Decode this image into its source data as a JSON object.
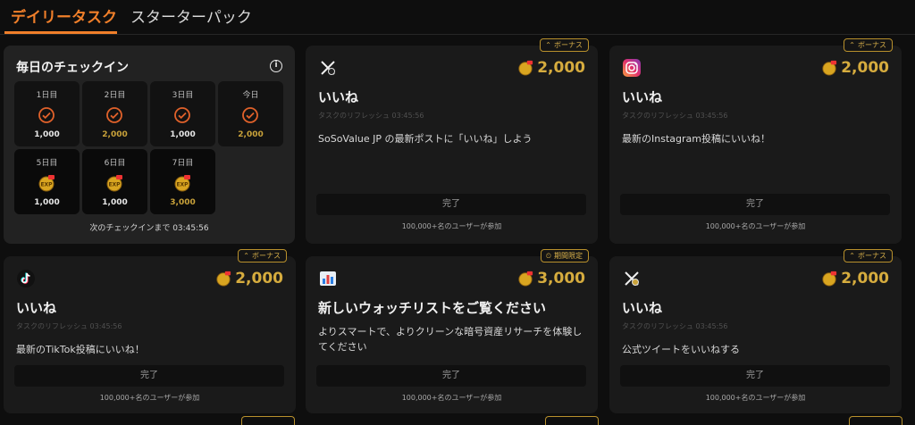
{
  "tabs": {
    "daily": "デイリータスク",
    "starter": "スターターパック"
  },
  "checkin": {
    "title": "毎日のチェックイン",
    "info_icon": "info-icon",
    "days": [
      {
        "label": "1日目",
        "amount": "1,000",
        "status": "done"
      },
      {
        "label": "2日目",
        "amount": "2,000",
        "status": "done"
      },
      {
        "label": "3日目",
        "amount": "1,000",
        "status": "done"
      },
      {
        "label": "今日",
        "amount": "2,000",
        "status": "done"
      },
      {
        "label": "5日目",
        "amount": "1,000",
        "status": "pending"
      },
      {
        "label": "6日目",
        "amount": "1,000",
        "status": "pending"
      },
      {
        "label": "7日目",
        "amount": "3,000",
        "status": "pending"
      }
    ],
    "footer": "次のチェックインまで 03:45:56"
  },
  "coin_badge": "EXP",
  "tasks": [
    {
      "icon": "x-logo-icon",
      "badge": "ボーナス",
      "badge_icon": "chevron-up-icon",
      "reward": "2,000",
      "title": "いいね",
      "refresh": "タスクのリフレッシュ 03:45:56",
      "desc": "SoSoValue JP の最新ポストに「いいね」しよう",
      "button": "完了",
      "users": "100,000+名のユーザーが参加"
    },
    {
      "icon": "instagram-icon",
      "badge": "ボーナス",
      "badge_icon": "chevron-up-icon",
      "reward": "2,000",
      "title": "いいね",
      "refresh": "タスクのリフレッシュ 03:45:56",
      "desc": "最新のInstagram投稿にいいね！",
      "button": "完了",
      "users": "100,000+名のユーザーが参加"
    },
    {
      "icon": "tiktok-icon",
      "badge": "ボーナス",
      "badge_icon": "chevron-up-icon",
      "reward": "2,000",
      "title": "いいね",
      "refresh": "タスクのリフレッシュ 03:45:56",
      "desc": "最新のTikTok投稿にいいね！",
      "button": "完了",
      "users": "100,000+名のユーザーが参加"
    },
    {
      "icon": "chart-icon",
      "badge": "期間限定",
      "badge_icon": "clock-icon",
      "reward": "3,000",
      "title": "新しいウォッチリストをご覧ください",
      "refresh": "",
      "desc": "よりスマートで、よりクリーンな暗号資産リサーチを体験してください",
      "button": "完了",
      "users": "100,000+名のユーザーが参加"
    },
    {
      "icon": "x-logo-icon",
      "badge": "ボーナス",
      "badge_icon": "chevron-up-icon",
      "reward": "2,000",
      "title": "いいね",
      "refresh": "タスクのリフレッシュ 03:45:56",
      "desc": "公式ツイートをいいねする",
      "button": "完了",
      "users": "100,000+名のユーザーが参加"
    }
  ],
  "colors": {
    "accent": "#f07f2a",
    "gold": "#d6ac3e",
    "card": "#1a1a1a"
  }
}
